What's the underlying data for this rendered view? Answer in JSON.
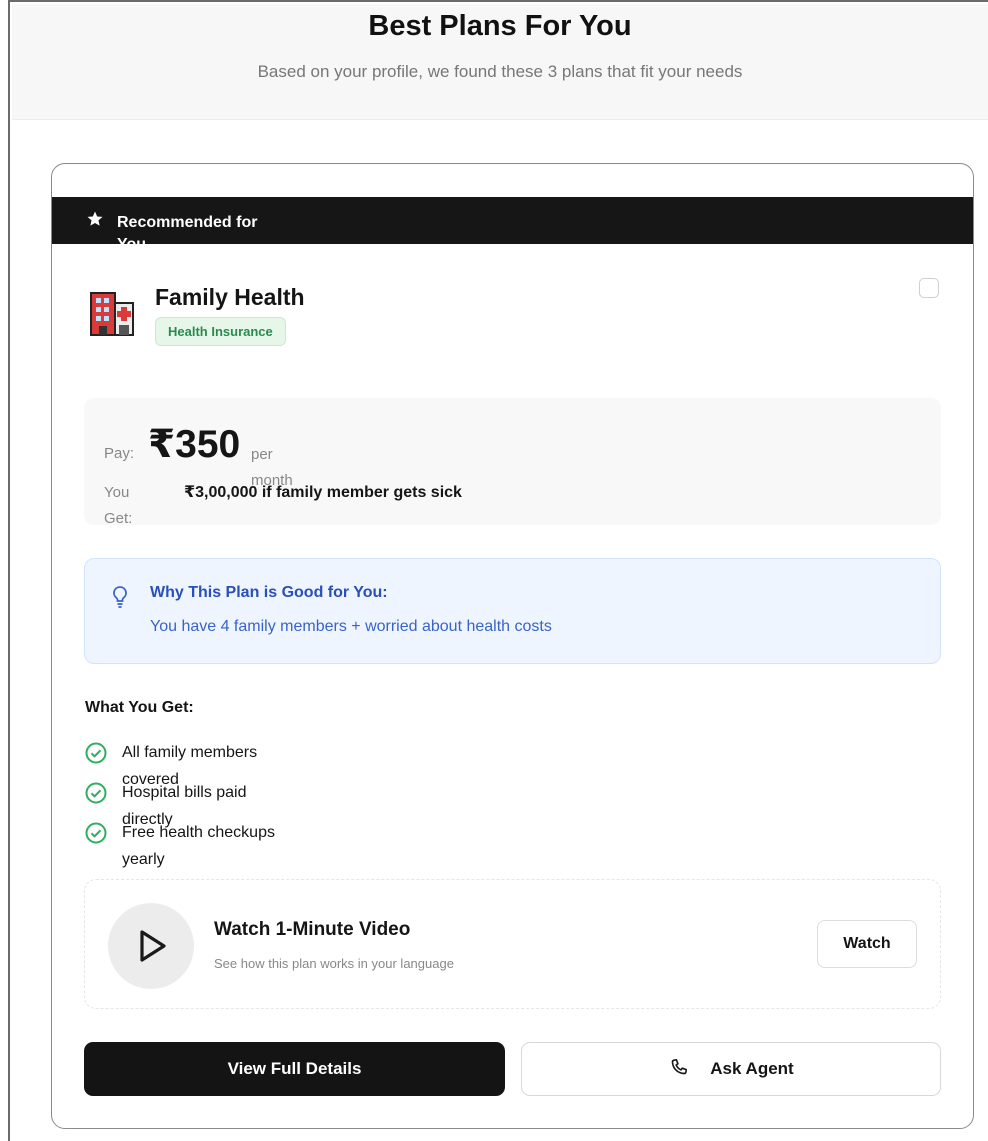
{
  "header": {
    "title": "Best Plans For You",
    "subtitle": "Based on your profile, we found these 3 plans that fit your needs"
  },
  "plan": {
    "recommended_label": "Recommended for You",
    "title": "Family Health",
    "badge": "Health Insurance",
    "pay_label": "Pay:",
    "pay_amount": "₹350",
    "pay_period": "per month",
    "get_label": "You Get:",
    "get_value": "₹3,00,000 if family member gets sick",
    "why_title": "Why This Plan is Good for You:",
    "why_text": "You have 4 family members + worried about health costs",
    "benefits_title": "What You Get:",
    "benefits": [
      "All family members covered",
      "Hospital bills paid directly",
      "Free health checkups yearly"
    ],
    "video_title": "Watch 1-Minute Video",
    "video_subtitle": "See how this plan works in your language",
    "watch_label": "Watch",
    "details_label": "View Full Details",
    "agent_label": "Ask Agent"
  },
  "colors": {
    "banner": "#161616",
    "badge_text": "#2d8a4e",
    "badge_bg": "#e6f7ea",
    "why_text": "#3a63c9",
    "why_bg": "#eef5ff",
    "check": "#2fae5e",
    "primary_button": "#141414"
  },
  "icons": {
    "banner": "star-icon",
    "plan": "hospital-icon",
    "why": "lightbulb-icon",
    "benefit": "check-circle-icon",
    "video": "play-icon",
    "agent": "phone-icon"
  }
}
